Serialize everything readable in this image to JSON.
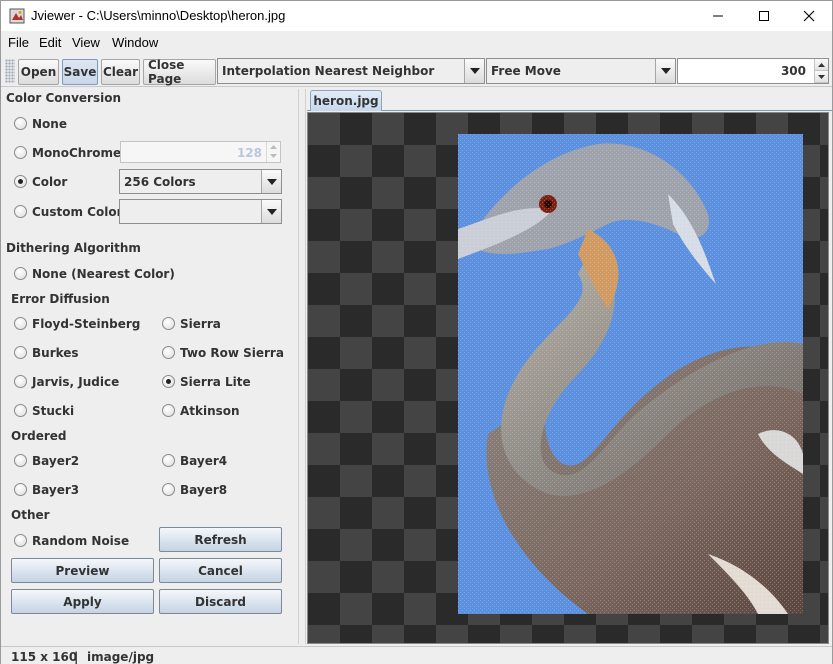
{
  "window": {
    "title": "Jviewer - C:\\Users\\minno\\Desktop\\heron.jpg"
  },
  "menu": [
    "File",
    "Edit",
    "View",
    "Window"
  ],
  "toolbar": {
    "open": "Open",
    "save": "Save",
    "clear": "Clear",
    "close_page": "Close Page",
    "interpolation": "Interpolation Nearest Neighbor",
    "move_mode": "Free Move",
    "zoom": "300"
  },
  "panel": {
    "color_conversion": "Color Conversion",
    "none": "None",
    "monochrome": "MonoChrome",
    "monochrome_value": "128",
    "color": "Color",
    "color_option": "256 Colors",
    "custom_color": "Custom Color",
    "dithering": "Dithering Algorithm",
    "none_nearest": "None (Nearest Color)",
    "error_diffusion": "Error Diffusion",
    "floyd": "Floyd-Steinberg",
    "sierra": "Sierra",
    "burkes": "Burkes",
    "two_row_sierra": "Two Row Sierra",
    "jarvis": "Jarvis, Judice",
    "sierra_lite": "Sierra Lite",
    "stucki": "Stucki",
    "atkinson": "Atkinson",
    "ordered": "Ordered",
    "bayer2": "Bayer2",
    "bayer4": "Bayer4",
    "bayer3": "Bayer3",
    "bayer8": "Bayer8",
    "other": "Other",
    "random_noise": "Random Noise",
    "refresh": "Refresh",
    "preview": "Preview",
    "cancel": "Cancel",
    "apply": "Apply",
    "discard": "Discard"
  },
  "viewer": {
    "tab": "heron.jpg"
  },
  "status": {
    "dimensions": "115 x 160",
    "separator": "|",
    "type": "image/jpg"
  }
}
